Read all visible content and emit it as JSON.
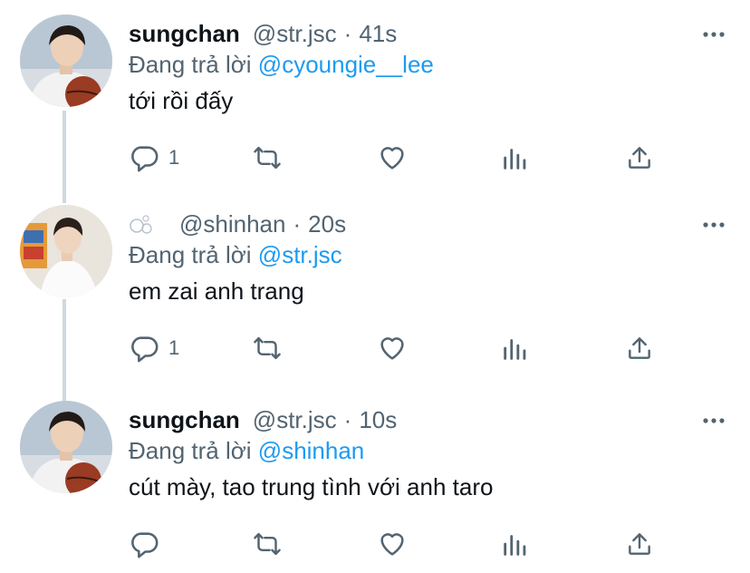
{
  "tweets": [
    {
      "name": "sungchan",
      "handle": "@str.jsc",
      "separator": "·",
      "time": "41s",
      "replying_prefix": "Đang trả lời",
      "replying_to": "@cyoungie__lee",
      "text": "tới rồi đấy",
      "reply_count": "1",
      "avatar": "avatar-basketball"
    },
    {
      "name": "",
      "handle": "@shinhan",
      "separator": "·",
      "time": "20s",
      "replying_prefix": "Đang trả lời",
      "replying_to": "@str.jsc",
      "text": "em zai anh trang",
      "reply_count": "1",
      "avatar": "avatar-white-sweater"
    },
    {
      "name": "sungchan",
      "handle": "@str.jsc",
      "separator": "·",
      "time": "10s",
      "replying_prefix": "Đang trả lời",
      "replying_to": "@shinhan",
      "text": "cút mày, tao trung tình với anh taro",
      "reply_count": "",
      "avatar": "avatar-basketball"
    }
  ],
  "icons": {
    "reply": "reply-icon",
    "retweet": "retweet-icon",
    "like": "heart-icon",
    "views": "views-icon",
    "share": "share-icon",
    "more": "more-icon"
  },
  "colors": {
    "mention": "#1d9bf0",
    "secondary_text": "#536471",
    "icon": "#536471",
    "thread_line": "#cfd9de"
  }
}
